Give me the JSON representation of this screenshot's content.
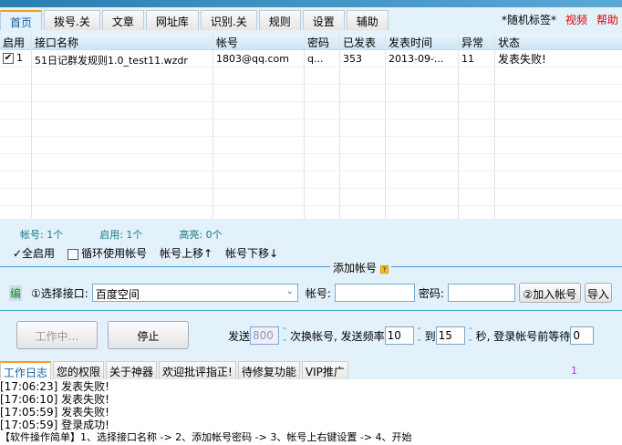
{
  "tabs": [
    "首页",
    "拨号.关",
    "文章",
    "网址库",
    "识别.关",
    "规则",
    "设置",
    "辅助"
  ],
  "right_links": {
    "random_tag": "*随机标签*",
    "video": "视频",
    "help": "帮助"
  },
  "table": {
    "columns": [
      "启用",
      "接口名称",
      "帐号",
      "密码",
      "已发表",
      "发表时间",
      "异常",
      "状态"
    ],
    "rows": [
      {
        "checked": true,
        "id": "1",
        "name": "51日记群发规则1.0_test11.wzdr",
        "account": "1803@qq.com",
        "password": "q...",
        "published": "353",
        "time": "2013-09-...",
        "errors": "11",
        "status": "发表失败!"
      }
    ]
  },
  "status": {
    "accounts": "帐号: 1个",
    "enabled": "启用: 1个",
    "highlight": "高亮: 0个"
  },
  "controls": {
    "enable_all": "✓全启用",
    "cycle": "循环使用帐号",
    "move_up": "帐号上移↑",
    "move_down": "帐号下移↓"
  },
  "add_account": {
    "title": "添加帐号",
    "edit": "编",
    "select_label": "①选择接口:",
    "interface_value": "百度空间",
    "account_label": "帐号:",
    "password_label": "密码:",
    "add_button": "②加入帐号",
    "import_button": "导入"
  },
  "run": {
    "working": "工作中…",
    "stop": "停止",
    "send_label": "发送",
    "send_value": "800",
    "switch_label": "次换帐号, 发送频率",
    "freq_from": "10",
    "to_label": "到",
    "freq_to": "15",
    "wait_label": "秒, 登录帐号前等待",
    "wait_value": "0"
  },
  "log_tabs": [
    "工作日志",
    "您的权限",
    "关于神器",
    "欢迎批评指正!",
    "待修复功能",
    "VIP推广"
  ],
  "log_counter": "1",
  "log": [
    "[17:06:23] 发表失败!",
    "[17:06:10] 发表失败!",
    "[17:05:59] 发表失败!",
    "[17:05:59] 登录成功!",
    "【软件操作简单】1、选择接口名称 -> 2、添加帐号密码 -> 3、帐号上右键设置 -> 4、开始"
  ],
  "colors": {
    "accent": "#1a5fa8",
    "link_red": "#e00000",
    "status_teal": "#1a7a8a"
  }
}
